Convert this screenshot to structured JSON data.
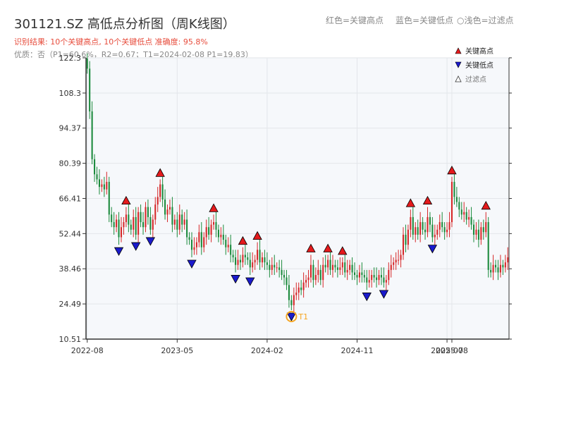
{
  "chart_data": {
    "type": "candlestick",
    "title": "301121.SZ 高低点分析图（周K线图）",
    "subtitle_result": "识别结果: 10个关键高点, 10个关键低点  准确度: 95.8%",
    "subtitle_quality": "优质：否（P1=60.6%，R2=0.67；T1=2024-02-08 P1=19.83）",
    "top_legend": {
      "red": "红色=关键高点",
      "blue": "蓝色=关键低点",
      "light": "○浅色=过滤点"
    },
    "legend": [
      "关键高点",
      "关键低点",
      "过滤点"
    ],
    "yticks": [
      10.51,
      24.49,
      38.46,
      52.44,
      66.41,
      80.39,
      94.37,
      108.3,
      122.3
    ],
    "ylim": [
      10.51,
      122.3
    ],
    "xticks": [
      "2022-08",
      "2023-05",
      "2024-02",
      "2024-11",
      "2025-07",
      "2025-08"
    ],
    "xtick_weeks": [
      0,
      37,
      74,
      111,
      148,
      150
    ],
    "annotation_label": "T1",
    "colors": {
      "up": "#d62728",
      "down": "#1b8a3c",
      "high": "#e41a1c",
      "low": "#1a1acc",
      "t1": "#f5a623"
    },
    "prices": [
      118,
      101,
      82,
      76,
      74,
      71,
      72,
      70,
      73,
      60,
      57,
      55,
      58,
      51,
      55,
      57,
      60,
      56,
      54,
      59,
      52,
      61,
      57,
      55,
      63,
      59,
      54,
      58,
      64,
      67,
      72,
      66,
      60,
      62,
      63,
      56,
      58,
      54,
      60,
      56,
      58,
      51,
      50,
      46,
      47,
      49,
      53,
      47,
      51,
      55,
      52,
      56,
      57,
      54,
      51,
      52,
      50,
      47,
      48,
      44,
      43,
      40,
      42,
      41,
      44,
      43,
      42,
      39,
      41,
      42,
      46,
      41,
      43,
      41,
      40,
      38,
      40,
      39,
      39,
      38,
      36,
      35,
      32,
      26,
      24,
      28,
      29,
      31,
      30,
      33,
      34,
      35,
      40,
      34,
      36,
      38,
      34,
      40,
      39,
      42,
      38,
      40,
      39,
      38,
      39,
      41,
      37,
      38,
      40,
      37,
      36,
      35,
      37,
      36,
      35,
      33,
      34,
      36,
      35,
      34,
      36,
      35,
      33,
      34,
      38,
      40,
      41,
      42,
      42,
      44,
      52,
      48,
      54,
      59,
      52,
      55,
      52,
      57,
      54,
      53,
      59,
      56,
      51,
      52,
      54,
      57,
      55,
      53,
      54,
      57,
      73,
      67,
      65,
      62,
      60,
      61,
      58,
      59,
      56,
      52,
      54,
      50,
      55,
      53,
      57,
      38,
      37,
      40,
      39,
      37,
      40,
      39,
      41,
      43
    ]
  }
}
